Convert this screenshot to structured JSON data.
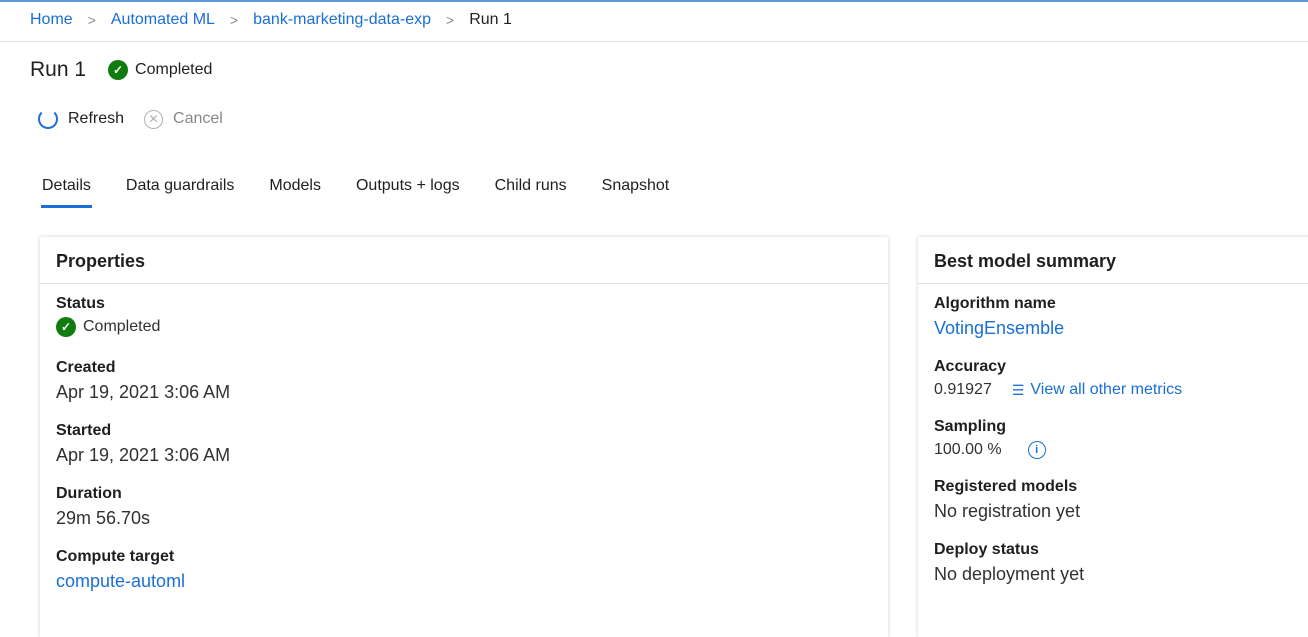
{
  "breadcrumb": [
    "Home",
    "Automated ML",
    "bank-marketing-data-exp",
    "Run 1"
  ],
  "header": {
    "title": "Run 1",
    "status": "Completed"
  },
  "toolbar": {
    "refresh": "Refresh",
    "cancel": "Cancel"
  },
  "tabs": [
    "Details",
    "Data guardrails",
    "Models",
    "Outputs + logs",
    "Child runs",
    "Snapshot"
  ],
  "properties": {
    "title": "Properties",
    "status_label": "Status",
    "status": "Completed",
    "created_label": "Created",
    "created": "Apr 19, 2021 3:06 AM",
    "started_label": "Started",
    "started": "Apr 19, 2021 3:06 AM",
    "duration_label": "Duration",
    "duration": "29m 56.70s",
    "compute_label": "Compute target",
    "compute": "compute-automl"
  },
  "summary": {
    "title": "Best model summary",
    "algorithm_label": "Algorithm name",
    "algorithm": "VotingEnsemble",
    "accuracy_label": "Accuracy",
    "accuracy": "0.91927",
    "metrics_link": "View all other metrics",
    "sampling_label": "Sampling",
    "sampling": "100.00 %",
    "registered_label": "Registered models",
    "registered": "No registration yet",
    "deploy_label": "Deploy status",
    "deploy": "No deployment yet"
  },
  "colors": {
    "accent": "#1a6fd6",
    "success": "#107c10"
  }
}
